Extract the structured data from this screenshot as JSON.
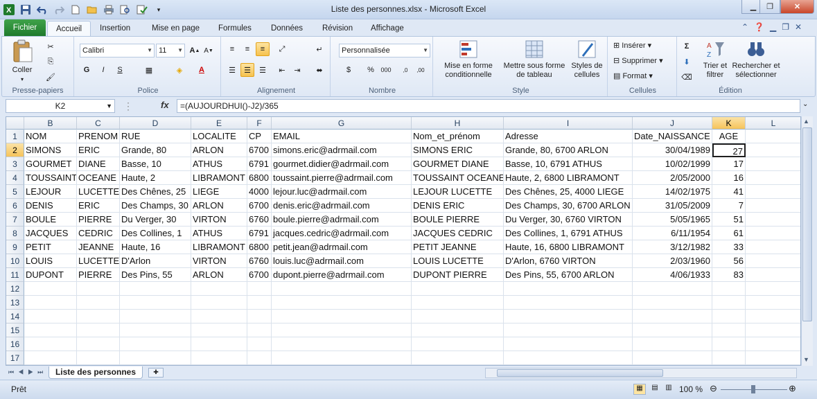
{
  "title": "Liste des personnes.xlsx  -  Microsoft Excel",
  "ribbon_tabs": [
    "Fichier",
    "Accueil",
    "Insertion",
    "Mise en page",
    "Formules",
    "Données",
    "Révision",
    "Affichage"
  ],
  "clipboard": {
    "paste_label": "Coller",
    "group": "Presse-papiers"
  },
  "font": {
    "name": "Calibri",
    "size": "11",
    "group": "Police"
  },
  "alignment": {
    "group": "Alignement"
  },
  "number": {
    "format": "Personnalisée",
    "group": "Nombre"
  },
  "style": {
    "cond_format": "Mise en forme conditionnelle",
    "table_format": "Mettre sous forme de tableau",
    "cell_styles": "Styles de cellules",
    "group": "Style"
  },
  "cells_group": {
    "insert": "Insérer",
    "delete": "Supprimer",
    "format": "Format",
    "group": "Cellules"
  },
  "editing": {
    "sort": "Trier et filtrer",
    "find": "Rechercher et sélectionner",
    "group": "Édition"
  },
  "formula_bar": {
    "name_box": "K2",
    "fx": "fx",
    "formula": "=(AUJOURDHUI()-J2)/365"
  },
  "columns": [
    "B",
    "C",
    "D",
    "E",
    "F",
    "G",
    "H",
    "I",
    "J",
    "K",
    "L"
  ],
  "headers": [
    "NOM",
    "PRENOM",
    "RUE",
    "LOCALITE",
    "CP",
    "EMAIL",
    "Nom_et_prénom",
    "Adresse",
    "Date_NAISSANCE",
    "AGE"
  ],
  "rows": [
    [
      "SIMONS",
      "ERIC",
      "Grande, 80",
      "ARLON",
      "6700",
      "simons.eric@adrmail.com",
      "SIMONS ERIC",
      "Grande, 80, 6700 ARLON",
      "30/04/1989",
      "27"
    ],
    [
      "GOURMET",
      "DIANE",
      "Basse, 10",
      "ATHUS",
      "6791",
      "gourmet.didier@adrmail.com",
      "GOURMET DIANE",
      "Basse, 10, 6791 ATHUS",
      "10/02/1999",
      "17"
    ],
    [
      "TOUSSAINT",
      "OCEANE",
      "Haute, 2",
      "LIBRAMONT",
      "6800",
      "toussaint.pierre@adrmail.com",
      "TOUSSAINT OCEANE",
      "Haute, 2, 6800 LIBRAMONT",
      "2/05/2000",
      "16"
    ],
    [
      "LEJOUR",
      "LUCETTE",
      "Des Chênes, 25",
      "LIEGE",
      "4000",
      "lejour.luc@adrmail.com",
      "LEJOUR LUCETTE",
      "Des Chênes, 25, 4000 LIEGE",
      "14/02/1975",
      "41"
    ],
    [
      "DENIS",
      "ERIC",
      "Des Champs, 30",
      "ARLON",
      "6700",
      "denis.eric@adrmail.com",
      "DENIS ERIC",
      "Des Champs, 30, 6700 ARLON",
      "31/05/2009",
      "7"
    ],
    [
      "BOULE",
      "PIERRE",
      "Du Verger, 30",
      "VIRTON",
      "6760",
      "boule.pierre@adrmail.com",
      "BOULE PIERRE",
      "Du Verger, 30, 6760 VIRTON",
      "5/05/1965",
      "51"
    ],
    [
      "JACQUES",
      "CEDRIC",
      "Des Collines, 1",
      "ATHUS",
      "6791",
      "jacques.cedric@adrmail.com",
      "JACQUES CEDRIC",
      "Des Collines, 1, 6791 ATHUS",
      "6/11/1954",
      "61"
    ],
    [
      "PETIT",
      "JEANNE",
      "Haute, 16",
      "LIBRAMONT",
      "6800",
      "petit.jean@adrmail.com",
      "PETIT JEANNE",
      "Haute, 16, 6800 LIBRAMONT",
      "3/12/1982",
      "33"
    ],
    [
      "LOUIS",
      "LUCETTE",
      "D'Arlon",
      "VIRTON",
      "6760",
      "louis.luc@adrmail.com",
      "LOUIS LUCETTE",
      "D'Arlon, 6760 VIRTON",
      "2/03/1960",
      "56"
    ],
    [
      "DUPONT",
      "PIERRE",
      "Des Pins, 55",
      "ARLON",
      "6700",
      "dupont.pierre@adrmail.com",
      "DUPONT PIERRE",
      "Des Pins, 55, 6700 ARLON",
      "4/06/1933",
      "83"
    ]
  ],
  "row_numbers": [
    "1",
    "2",
    "3",
    "4",
    "5",
    "6",
    "7",
    "8",
    "9",
    "10",
    "11",
    "12",
    "13",
    "14",
    "15",
    "16",
    "17"
  ],
  "sheet_tab": "Liste des personnes",
  "status": {
    "ready": "Prêt",
    "zoom": "100 %"
  }
}
